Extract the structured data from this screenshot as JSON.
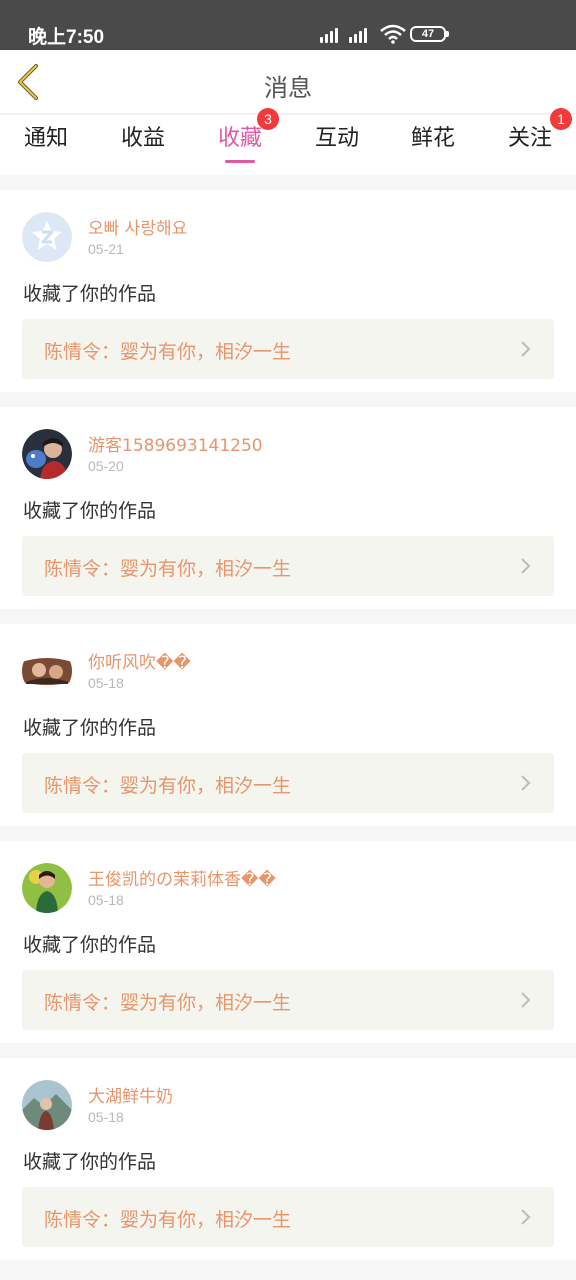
{
  "status_bar": {
    "time": "晚上7:50",
    "battery": "47",
    "signal_icons": [
      "signal-icon",
      "signal-icon",
      "wifi-icon",
      "battery-icon"
    ]
  },
  "header": {
    "title": "消息",
    "back_icon": "chevron-left-icon"
  },
  "tabs": [
    {
      "label": "通知",
      "badge": ""
    },
    {
      "label": "收益",
      "badge": ""
    },
    {
      "label": "收藏",
      "badge": "3",
      "active": true
    },
    {
      "label": "互动",
      "badge": ""
    },
    {
      "label": "鲜花",
      "badge": ""
    },
    {
      "label": "关注",
      "badge": "1"
    }
  ],
  "colors": {
    "accent": "#e05aa0",
    "badge": "#f23a3a",
    "name": "#e8956a",
    "link_bg": "#f5f5ef"
  },
  "items": [
    {
      "name": "오빠 사랑해요",
      "date": "05-21",
      "action": "收藏了你的作品",
      "work": "陈情令：婴为有你，相汐一生",
      "avatar": "default-avatar-icon"
    },
    {
      "name": "游客1589693141250",
      "date": "05-20",
      "action": "收藏了你的作品",
      "work": "陈情令：婴为有你，相汐一生",
      "avatar": "user-avatar"
    },
    {
      "name": "你听风吹��",
      "date": "05-18",
      "action": "收藏了你的作品",
      "work": "陈情令：婴为有你，相汐一生",
      "avatar": "user-avatar"
    },
    {
      "name": "王俊凯的の茉莉体香��",
      "date": "05-18",
      "action": "收藏了你的作品",
      "work": "陈情令：婴为有你，相汐一生",
      "avatar": "user-avatar"
    },
    {
      "name": "大湖鲜牛奶",
      "date": "05-18",
      "action": "收藏了你的作品",
      "work": "陈情令：婴为有你，相汐一生",
      "avatar": "user-avatar"
    }
  ]
}
